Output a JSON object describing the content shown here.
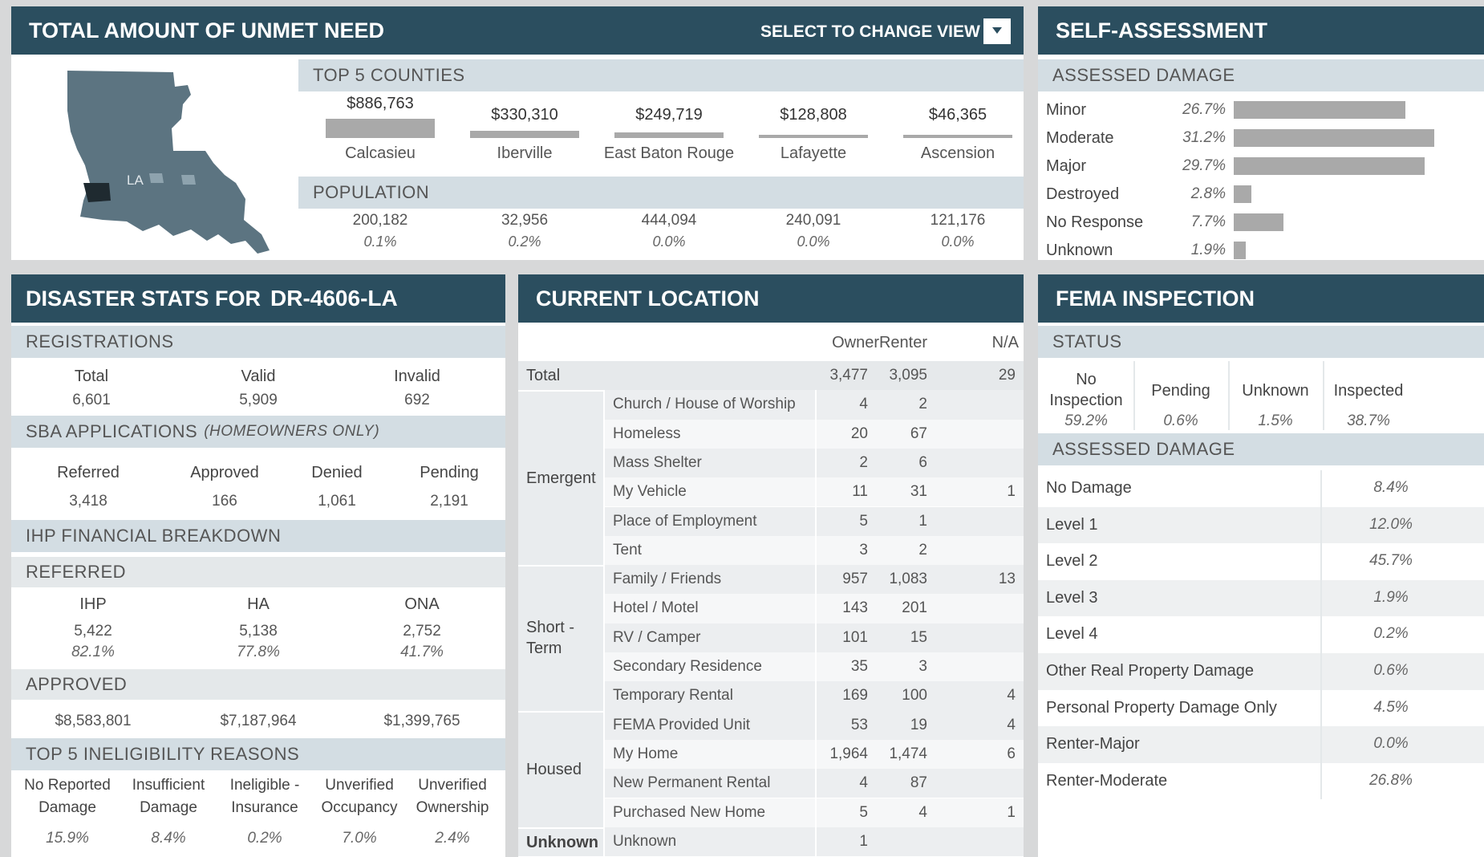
{
  "unmet": {
    "title": "TOTAL AMOUNT OF UNMET NEED",
    "select_label": "SELECT TO CHANGE VIEW",
    "map_label": "LA",
    "top5_label": "TOP 5 COUNTIES",
    "population_label": "POPULATION",
    "counties": [
      {
        "amount": "$886,763",
        "name": "Calcasieu",
        "population": "200,182",
        "pct": "0.1%",
        "bar": 1.0
      },
      {
        "amount": "$330,310",
        "name": "Iberville",
        "population": "32,956",
        "pct": "0.2%",
        "bar": 0.37
      },
      {
        "amount": "$249,719",
        "name": "East Baton Rouge",
        "population": "444,094",
        "pct": "0.0%",
        "bar": 0.28
      },
      {
        "amount": "$128,808",
        "name": "Lafayette",
        "population": "240,091",
        "pct": "0.0%",
        "bar": 0.15
      },
      {
        "amount": "$46,365",
        "name": "Ascension",
        "population": "121,176",
        "pct": "0.0%",
        "bar": 0.05
      }
    ]
  },
  "self_assessment": {
    "title": "SELF-ASSESSMENT",
    "section": "ASSESSED DAMAGE",
    "rows": [
      {
        "label": "Minor",
        "pct": "26.7%",
        "value": 26.7
      },
      {
        "label": "Moderate",
        "pct": "31.2%",
        "value": 31.2
      },
      {
        "label": "Major",
        "pct": "29.7%",
        "value": 29.7
      },
      {
        "label": "Destroyed",
        "pct": "2.8%",
        "value": 2.8
      },
      {
        "label": "No Response",
        "pct": "7.7%",
        "value": 7.7
      },
      {
        "label": "Unknown",
        "pct": "1.9%",
        "value": 1.9
      }
    ]
  },
  "disaster": {
    "title_prefix": "DISASTER STATS FOR",
    "title_id": "DR-4606-LA",
    "registrations_label": "REGISTRATIONS",
    "registrations": [
      {
        "label": "Total",
        "value": "6,601"
      },
      {
        "label": "Valid",
        "value": "5,909"
      },
      {
        "label": "Invalid",
        "value": "692"
      }
    ],
    "sba_label": "SBA APPLICATIONS",
    "sba_note": "(HOMEOWNERS ONLY)",
    "sba": [
      {
        "label": "Referred",
        "value": "3,418"
      },
      {
        "label": "Approved",
        "value": "166"
      },
      {
        "label": "Denied",
        "value": "1,061"
      },
      {
        "label": "Pending",
        "value": "2,191"
      }
    ],
    "ihp_label": "IHP FINANCIAL BREAKDOWN",
    "referred_label": "REFERRED",
    "ihp": [
      {
        "label": "IHP",
        "value": "5,422",
        "pct": "82.1%",
        "approved": "$8,583,801"
      },
      {
        "label": "HA",
        "value": "5,138",
        "pct": "77.8%",
        "approved": "$7,187,964"
      },
      {
        "label": "ONA",
        "value": "2,752",
        "pct": "41.7%",
        "approved": "$1,399,765"
      }
    ],
    "approved_label": "APPROVED",
    "inelig_label": "TOP 5 INELIGIBILITY REASONS",
    "inelig": [
      {
        "l1": "No Reported",
        "l2": "Damage",
        "pct": "15.9%"
      },
      {
        "l1": "Insufficient",
        "l2": "Damage",
        "pct": "8.4%"
      },
      {
        "l1": "Ineligible -",
        "l2": "Insurance",
        "pct": "0.2%"
      },
      {
        "l1": "Unverified",
        "l2": "Occupancy",
        "pct": "7.0%"
      },
      {
        "l1": "Unverified",
        "l2": "Ownership",
        "pct": "2.4%"
      }
    ]
  },
  "location": {
    "title": "CURRENT LOCATION",
    "columns": [
      "Owner",
      "Renter",
      "N/A"
    ],
    "total": {
      "label": "Total",
      "owner": "3,477",
      "renter": "3,095",
      "na": "29"
    },
    "groups": [
      {
        "name": "Emergent",
        "rows": [
          {
            "label": "Church / House of Worship",
            "owner": "4",
            "renter": "2",
            "na": ""
          },
          {
            "label": "Homeless",
            "owner": "20",
            "renter": "67",
            "na": ""
          },
          {
            "label": "Mass Shelter",
            "owner": "2",
            "renter": "6",
            "na": ""
          },
          {
            "label": "My Vehicle",
            "owner": "11",
            "renter": "31",
            "na": "1"
          },
          {
            "label": "Place of Employment",
            "owner": "5",
            "renter": "1",
            "na": ""
          },
          {
            "label": "Tent",
            "owner": "3",
            "renter": "2",
            "na": ""
          }
        ]
      },
      {
        "name": "Short - Term",
        "rows": [
          {
            "label": "Family / Friends",
            "owner": "957",
            "renter": "1,083",
            "na": "13"
          },
          {
            "label": "Hotel / Motel",
            "owner": "143",
            "renter": "201",
            "na": ""
          },
          {
            "label": "RV / Camper",
            "owner": "101",
            "renter": "15",
            "na": ""
          },
          {
            "label": "Secondary Residence",
            "owner": "35",
            "renter": "3",
            "na": ""
          },
          {
            "label": "Temporary Rental",
            "owner": "169",
            "renter": "100",
            "na": "4"
          }
        ]
      },
      {
        "name": "Housed",
        "rows": [
          {
            "label": "FEMA Provided Unit",
            "owner": "53",
            "renter": "19",
            "na": "4"
          },
          {
            "label": "My Home",
            "owner": "1,964",
            "renter": "1,474",
            "na": "6"
          },
          {
            "label": "New Permanent Rental",
            "owner": "4",
            "renter": "87",
            "na": ""
          },
          {
            "label": "Purchased New Home",
            "owner": "5",
            "renter": "4",
            "na": "1"
          }
        ]
      },
      {
        "name": "Unknown",
        "rows": [
          {
            "label": "Unknown",
            "owner": "1",
            "renter": "",
            "na": ""
          }
        ]
      }
    ]
  },
  "inspection": {
    "title": "FEMA INSPECTION",
    "status_label": "STATUS",
    "status": [
      {
        "l1": "No",
        "l2": "Inspection",
        "pct": "59.2%"
      },
      {
        "l1": "Pending",
        "l2": "",
        "pct": "0.6%"
      },
      {
        "l1": "Unknown",
        "l2": "",
        "pct": "1.5%"
      },
      {
        "l1": "Inspected",
        "l2": "",
        "pct": "38.7%"
      }
    ],
    "damage_label": "ASSESSED DAMAGE",
    "damage": [
      {
        "label": "No Damage",
        "pct": "8.4%"
      },
      {
        "label": "Level 1",
        "pct": "12.0%"
      },
      {
        "label": "Level 2",
        "pct": "45.7%"
      },
      {
        "label": "Level 3",
        "pct": "1.9%"
      },
      {
        "label": "Level 4",
        "pct": "0.2%"
      },
      {
        "label": "Other Real Property Damage",
        "pct": "0.6%"
      },
      {
        "label": "Personal Property Damage Only",
        "pct": "4.5%"
      },
      {
        "label": "Renter-Major",
        "pct": "0.0%"
      },
      {
        "label": "Renter-Moderate",
        "pct": "26.8%"
      }
    ]
  }
}
